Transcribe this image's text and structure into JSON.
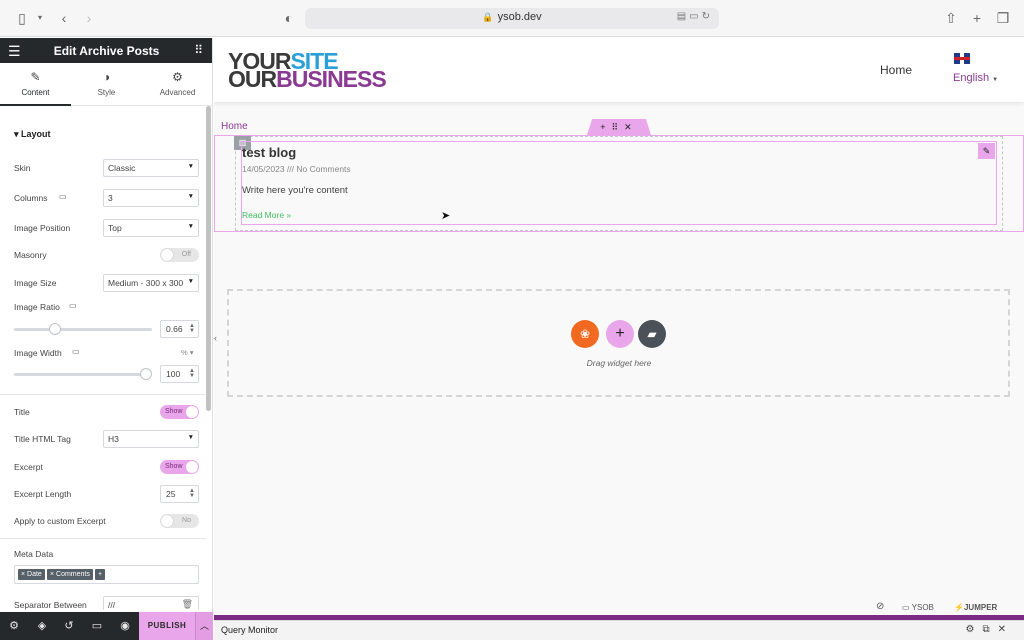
{
  "browser": {
    "url": "ysob.dev"
  },
  "sidebar": {
    "title": "Edit Archive Posts",
    "tabs": [
      {
        "label": "Content",
        "icon": "pencil-icon"
      },
      {
        "label": "Style",
        "icon": "contrast-icon"
      },
      {
        "label": "Advanced",
        "icon": "gear-icon"
      }
    ],
    "section": "Layout",
    "fields": {
      "skin_label": "Skin",
      "skin_value": "Classic",
      "columns_label": "Columns",
      "columns_value": "3",
      "image_position_label": "Image Position",
      "image_position_value": "Top",
      "masonry_label": "Masonry",
      "masonry_value": "Off",
      "image_size_label": "Image Size",
      "image_size_value": "Medium - 300 x 300",
      "image_ratio_label": "Image Ratio",
      "image_ratio_value": "0.66",
      "image_ratio_fraction": 0.28,
      "image_width_label": "Image Width",
      "image_width_unit": "%",
      "image_width_value": "100",
      "image_width_fraction": 1.0,
      "title_label": "Title",
      "title_value": "Show",
      "title_tag_label": "Title HTML Tag",
      "title_tag_value": "H3",
      "excerpt_label": "Excerpt",
      "excerpt_value": "Show",
      "excerpt_length_label": "Excerpt Length",
      "excerpt_length_value": "25",
      "custom_excerpt_label": "Apply to custom Excerpt",
      "custom_excerpt_value": "No",
      "meta_label": "Meta Data",
      "meta_tags": [
        "× Date",
        "× Comments"
      ],
      "meta_add": "+",
      "separator_label": "Separator Between",
      "separator_value": "///"
    },
    "footer": {
      "publish": "PUBLISH"
    }
  },
  "site": {
    "logo_line1_a": "YOUR",
    "logo_line1_b": "SITE",
    "logo_line2_a": "OUR",
    "logo_line2_b": "BUSINESS",
    "nav_home": "Home",
    "language": "English",
    "breadcrumb": "Home",
    "post": {
      "title": "test blog",
      "meta": "14/05/2023 /// No Comments",
      "excerpt": "Write here you're content",
      "read_more": "Read More »"
    },
    "drop_text": "Drag widget here",
    "footer_badges": [
      "YSOB",
      "JUMPER"
    ]
  },
  "query_monitor": "Query Monitor",
  "colors": {
    "accent": "#e9a6ea",
    "dark": "#26292c",
    "brand_blue": "#2a9fd8",
    "brand_purple": "#8b3a93",
    "link_green": "#3fbf5a",
    "orange": "#f26a22"
  }
}
